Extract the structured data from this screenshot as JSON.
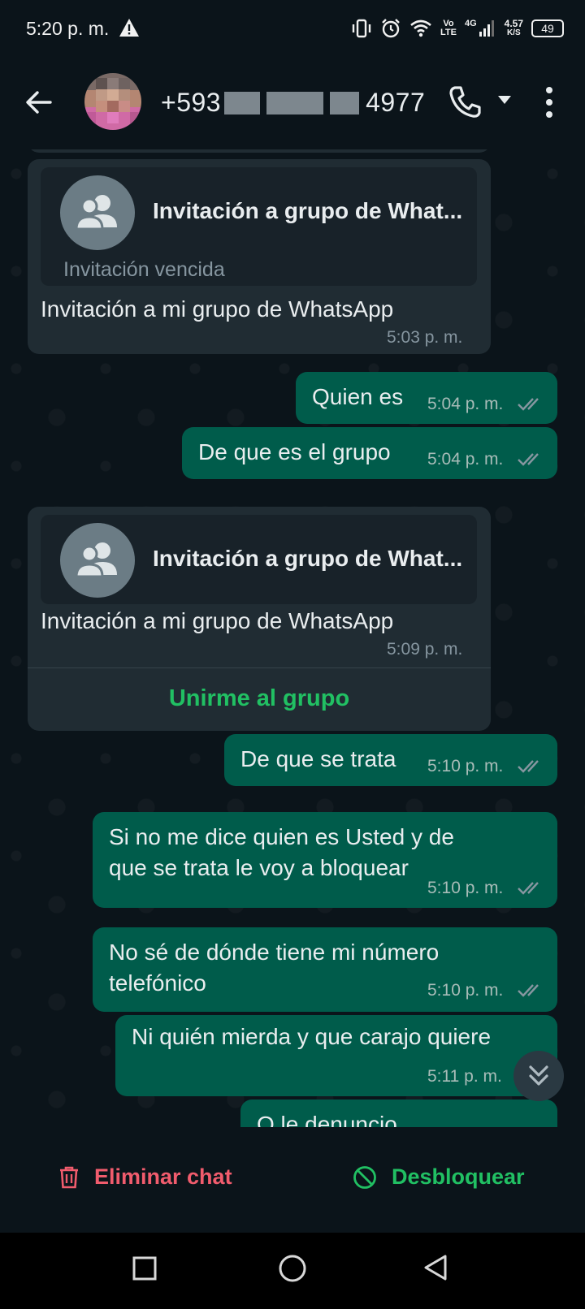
{
  "status_bar": {
    "time": "5:20 p. m.",
    "warning_icon": "warning-icon",
    "vo_lte_top": "Vo",
    "vo_lte_bottom": "LTE",
    "network": "4G",
    "speed_top": "4.57",
    "speed_bottom": "K/S",
    "battery": "49"
  },
  "header": {
    "contact_prefix": "+593",
    "contact_suffix": "4977",
    "back_icon": "arrow-left-icon",
    "call_icon": "phone-icon",
    "menu_icon": "more-vert-icon"
  },
  "messages": [
    {
      "type": "invite",
      "card_title": "Invitación a grupo de What...",
      "card_subtitle": "Invitación vencida",
      "text": "Invitación a mi grupo de WhatsApp",
      "time": "5:03 p. m."
    },
    {
      "type": "out",
      "text": "Quien es",
      "time": "5:04 p. m."
    },
    {
      "type": "out",
      "text": "De que es el grupo",
      "time": "5:04 p. m."
    },
    {
      "type": "invite",
      "card_title": "Invitación a grupo de What...",
      "text": "Invitación a mi grupo de WhatsApp",
      "time": "5:09 p. m.",
      "action": "Unirme al grupo"
    },
    {
      "type": "out",
      "text": "De que se trata",
      "time": "5:10 p. m."
    },
    {
      "type": "out",
      "text": "Si no me dice quien es Usted y de\nque se trata le voy a bloquear",
      "time": "5:10 p. m."
    },
    {
      "type": "out",
      "text": "No sé de dónde tiene mi número\ntelefónico",
      "time": "5:10 p. m."
    },
    {
      "type": "out",
      "text": "Ni quién mierda y que carajo quiere",
      "time": "5:11 p. m."
    },
    {
      "type": "out",
      "text": "O le denuncio"
    }
  ],
  "bottom_actions": {
    "delete_label": "Eliminar chat",
    "unblock_label": "Desbloquear"
  },
  "colors": {
    "background": "#0b141a",
    "incoming": "#202c33",
    "outgoing": "#005c4b",
    "accent_green": "#21c063",
    "danger_red": "#f15c6d"
  }
}
